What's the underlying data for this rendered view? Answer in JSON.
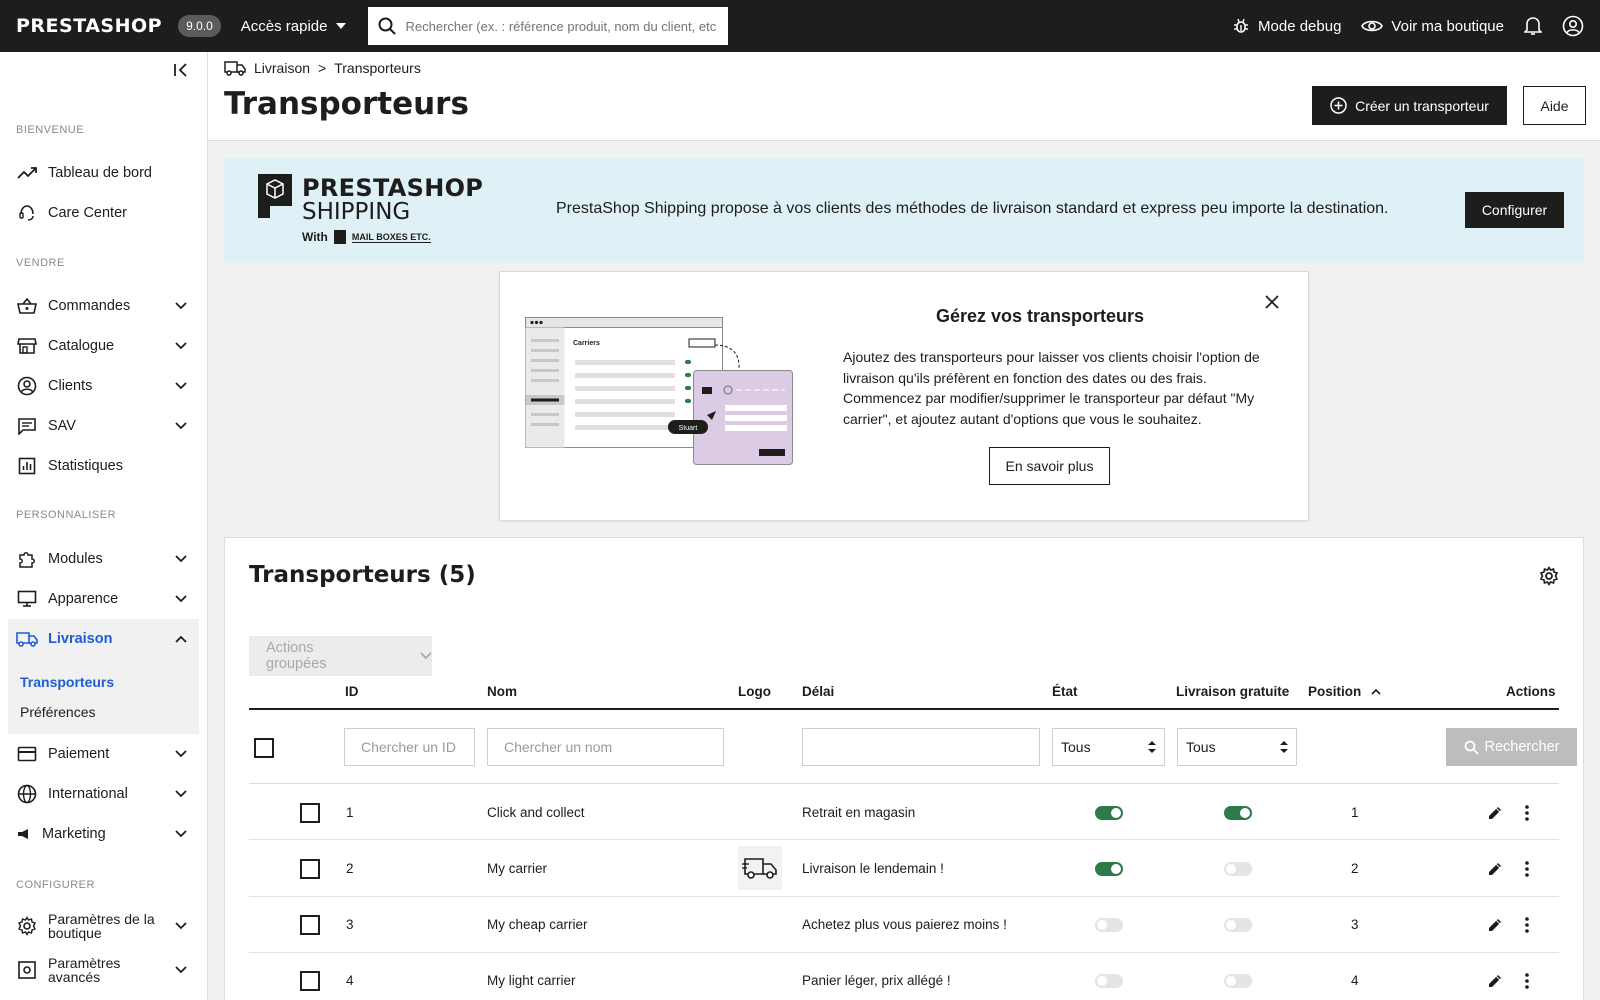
{
  "topbar": {
    "brand": "PRESTASHOP",
    "version": "9.0.0",
    "quick_access": "Accès rapide",
    "search_placeholder": "Rechercher (ex. : référence produit, nom du client, etc.)",
    "debug": "Mode debug",
    "view_shop": "Voir ma boutique"
  },
  "sidebar": {
    "sections": [
      "BIENVENUE",
      "VENDRE",
      "PERSONNALISER",
      "CONFIGURER"
    ],
    "items": [
      {
        "label": "Tableau de bord",
        "icon": "trending-up-icon"
      },
      {
        "label": "Care Center",
        "icon": "headset-icon"
      },
      {
        "label": "Commandes",
        "icon": "basket-icon"
      },
      {
        "label": "Catalogue",
        "icon": "store-icon"
      },
      {
        "label": "Clients",
        "icon": "user-circle-icon"
      },
      {
        "label": "SAV",
        "icon": "chat-icon"
      },
      {
        "label": "Statistiques",
        "icon": "bar-chart-icon"
      },
      {
        "label": "Modules",
        "icon": "puzzle-icon"
      },
      {
        "label": "Apparence",
        "icon": "monitor-icon"
      },
      {
        "label": "Livraison",
        "icon": "truck-icon"
      },
      {
        "label": "Paiement",
        "icon": "credit-card-icon"
      },
      {
        "label": "International",
        "icon": "globe-icon"
      },
      {
        "label": "Marketing",
        "icon": "megaphone-icon"
      },
      {
        "label": "Paramètres de la boutique",
        "icon": "gear-icon"
      },
      {
        "label": "Paramètres avancés",
        "icon": "settings-box-icon"
      }
    ],
    "sub_items": [
      "Transporteurs",
      "Préférences"
    ]
  },
  "header": {
    "breadcrumb_parent": "Livraison",
    "breadcrumb_sep": ">",
    "breadcrumb_current": "Transporteurs",
    "title": "Transporteurs",
    "create_button": "Créer un transporteur",
    "help_button": "Aide"
  },
  "banner": {
    "logo_line1": "PRESTASHOP",
    "logo_line2": "SHIPPING",
    "logo_with": "With",
    "logo_partner": "MAIL BOXES ETC.",
    "text": "PrestaShop Shipping propose à vos clients des méthodes de livraison standard et express peu importe la destination.",
    "configure_button": "Configurer"
  },
  "info_card": {
    "title": "Gérez vos transporteurs",
    "body": "Ajoutez des transporteurs pour laisser vos clients choisir l'option de livraison qu'ils préfèrent en fonction des dates ou des frais. Commencez par modifier/supprimer le transporteur par défaut \"My carrier\", et ajoutez autant d'options que vous le souhaitez.",
    "learn_more": "En savoir plus",
    "illus_title": "Carriers",
    "illus_badge": "Stuart"
  },
  "panel": {
    "title": "Transporteurs (5)",
    "bulk_actions": "Actions groupées",
    "columns": {
      "id": "ID",
      "name": "Nom",
      "logo": "Logo",
      "delay": "Délai",
      "status": "État",
      "free_shipping": "Livraison gratuite",
      "position": "Position",
      "actions": "Actions"
    },
    "filters": {
      "id_placeholder": "Chercher un ID",
      "name_placeholder": "Chercher un nom",
      "status_value": "Tous",
      "free_value": "Tous",
      "search_button": "Rechercher"
    },
    "rows": [
      {
        "id": "1",
        "name": "Click and collect",
        "delay": "Retrait en magasin",
        "active": true,
        "free": true,
        "position": "1",
        "has_logo": false
      },
      {
        "id": "2",
        "name": "My carrier",
        "delay": "Livraison le lendemain !",
        "active": true,
        "free": false,
        "position": "2",
        "has_logo": true
      },
      {
        "id": "3",
        "name": "My cheap carrier",
        "delay": "Achetez plus vous paierez moins !",
        "active": false,
        "free": false,
        "position": "3",
        "has_logo": false
      },
      {
        "id": "4",
        "name": "My light carrier",
        "delay": "Panier léger, prix allégé !",
        "active": false,
        "free": false,
        "position": "4",
        "has_logo": false
      }
    ]
  },
  "colors": {
    "dark": "#1d1d1b",
    "accent": "#1e5dd6",
    "toggle_on": "#2d7a4a",
    "banner_bg": "#dff0f6"
  }
}
